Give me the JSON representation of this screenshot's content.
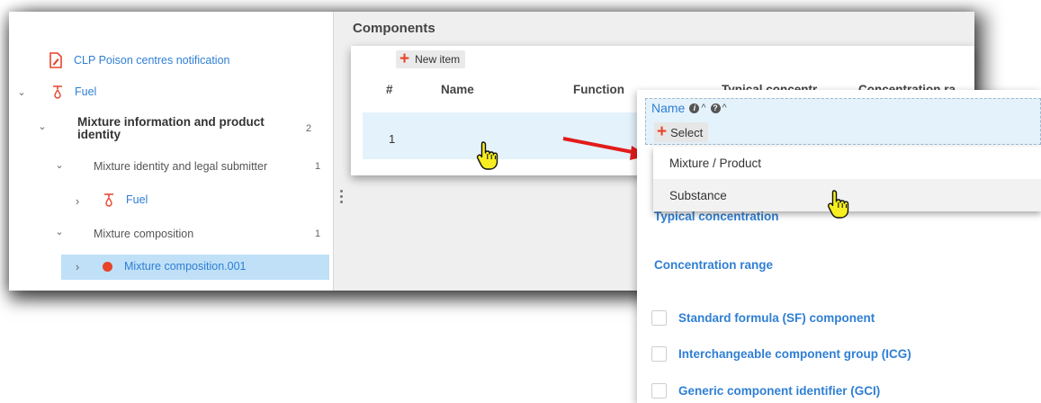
{
  "tree": {
    "root_label": "CLP Poison centres notification",
    "fuel_label": "Fuel",
    "mixture_info_label": "Mixture information and product identity",
    "mixture_info_count": "2",
    "identity_label": "Mixture identity and legal submitter",
    "identity_count": "1",
    "fuel_child_label": "Fuel",
    "composition_label": "Mixture composition",
    "composition_count": "1",
    "composition_item_label": "Mixture composition.001"
  },
  "components": {
    "title": "Components",
    "new_item_label": "New item",
    "columns": [
      "#",
      "Name",
      "Function",
      "Typical concentr",
      "Concentration ra"
    ],
    "rows": [
      {
        "index": "1"
      }
    ]
  },
  "popup": {
    "name_label": "Name",
    "select_label": "Select",
    "options": [
      "Mixture / Product",
      "Substance"
    ],
    "typical_concentration": "Typical concentration",
    "concentration_range": "Concentration range",
    "checkboxes": [
      "Standard formula (SF) component",
      "Interchangeable component group (ICG)",
      "Generic component identifier (GCI)"
    ]
  },
  "colors": {
    "accent": "#2f7fd4",
    "plus": "#e8442a",
    "selected_row": "#bfe0f7",
    "arrow": "#e31b1b"
  }
}
